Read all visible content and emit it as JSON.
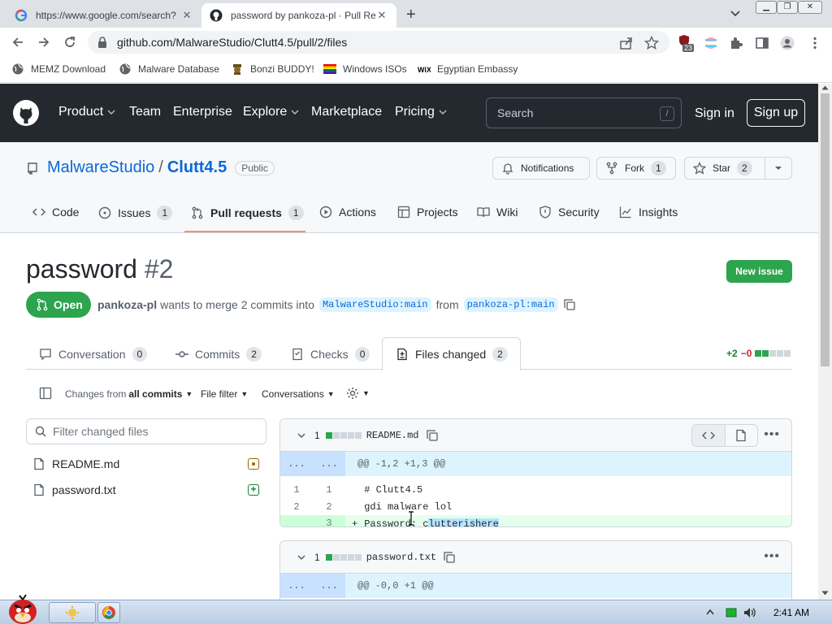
{
  "browser": {
    "tabs": [
      {
        "title": "https://www.google.com/search?",
        "active": false
      },
      {
        "title": "password by pankoza-pl · Pull Re",
        "active": true
      }
    ],
    "url": "github.com/MalwareStudio/Clutt4.5/pull/2/files",
    "extension_badge": "23",
    "bookmarks": [
      {
        "label": "MEMZ Download",
        "icon": "globe-icon"
      },
      {
        "label": "Malware Database",
        "icon": "globe-icon"
      },
      {
        "label": "Bonzi BUDDY!",
        "icon": "bonzi-icon"
      },
      {
        "label": "Windows ISOs",
        "icon": "rainbow-flag-icon"
      },
      {
        "label": "Egyptian Embassy",
        "icon": "wix-icon"
      }
    ]
  },
  "github_header": {
    "nav": [
      {
        "label": "Product",
        "dropdown": true
      },
      {
        "label": "Team",
        "dropdown": false
      },
      {
        "label": "Enterprise",
        "dropdown": false
      },
      {
        "label": "Explore",
        "dropdown": true
      },
      {
        "label": "Marketplace",
        "dropdown": false
      },
      {
        "label": "Pricing",
        "dropdown": true
      }
    ],
    "search_placeholder": "Search",
    "search_key": "/",
    "sign_in": "Sign in",
    "sign_up": "Sign up"
  },
  "repo": {
    "owner": "MalwareStudio",
    "separator": "/",
    "name": "Clutt4.5",
    "visibility": "Public",
    "notifications": "Notifications",
    "fork_label": "Fork",
    "fork_count": "1",
    "star_label": "Star",
    "star_count": "2",
    "tabs": [
      {
        "label": "Code",
        "count": ""
      },
      {
        "label": "Issues",
        "count": "1"
      },
      {
        "label": "Pull requests",
        "count": "1"
      },
      {
        "label": "Actions",
        "count": ""
      },
      {
        "label": "Projects",
        "count": ""
      },
      {
        "label": "Wiki",
        "count": ""
      },
      {
        "label": "Security",
        "count": ""
      },
      {
        "label": "Insights",
        "count": ""
      }
    ]
  },
  "pr": {
    "title": "password",
    "number": "#2",
    "new_issue": "New issue",
    "state": "Open",
    "author": "pankoza-pl",
    "merge_text": "wants to merge 2 commits into",
    "base_branch": "MalwareStudio:main",
    "from_text": "from",
    "head_branch": "pankoza-pl:main",
    "tabs": [
      {
        "label": "Conversation",
        "count": "0"
      },
      {
        "label": "Commits",
        "count": "2"
      },
      {
        "label": "Checks",
        "count": "0"
      },
      {
        "label": "Files changed",
        "count": "2"
      }
    ],
    "additions": "+2",
    "deletions": "−0"
  },
  "diff_toolbar": {
    "changes_prefix": "Changes from",
    "changes_value": "all commits",
    "file_filter": "File filter",
    "conversations": "Conversations"
  },
  "file_tree": {
    "filter_placeholder": "Filter changed files",
    "files": [
      {
        "name": "README.md",
        "status": "modified"
      },
      {
        "name": "password.txt",
        "status": "added"
      }
    ]
  },
  "diffs": [
    {
      "changes": "1",
      "filename": "README.md",
      "hunk_marker": "...",
      "hunk": "@@ -1,2 +1,3 @@",
      "lines": [
        {
          "old": "1",
          "new": "1",
          "prefix": " ",
          "text": "# Clutt4.5"
        },
        {
          "old": "2",
          "new": "2",
          "prefix": " ",
          "text": "gdi malware lol"
        },
        {
          "old": "",
          "new": "3",
          "prefix": "+",
          "text_before": "Password: c",
          "text_selected": "lutterishere"
        }
      ]
    },
    {
      "changes": "1",
      "filename": "password.txt",
      "hunk_marker": "...",
      "hunk": "@@ -0,0 +1 @@"
    }
  ],
  "taskbar": {
    "clock": "2:41 AM"
  }
}
